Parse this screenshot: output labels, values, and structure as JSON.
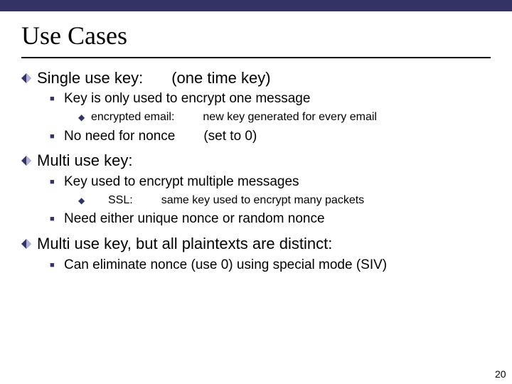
{
  "title": "Use Cases",
  "sections": [
    {
      "heading_a": "Single use key:",
      "heading_b": "(one time key)",
      "items": [
        {
          "text": "Key is only used to encrypt one message",
          "sub": [
            {
              "a": "encrypted email:",
              "b": "new key generated for every email"
            }
          ]
        },
        {
          "text_a": "No need for nonce",
          "text_b": "(set to 0)"
        }
      ]
    },
    {
      "heading_a": "Multi use key:",
      "items": [
        {
          "text": "Key used to encrypt multiple messages",
          "sub": [
            {
              "a": "SSL:",
              "b": "same key used to encrypt many packets"
            }
          ]
        },
        {
          "text": "Need either unique nonce or random nonce"
        }
      ]
    },
    {
      "heading_a": "Multi use key, but all plaintexts are distinct:",
      "items": [
        {
          "text": "Can eliminate nonce (use 0) using special mode (SIV)"
        }
      ]
    }
  ],
  "page_number": "20"
}
